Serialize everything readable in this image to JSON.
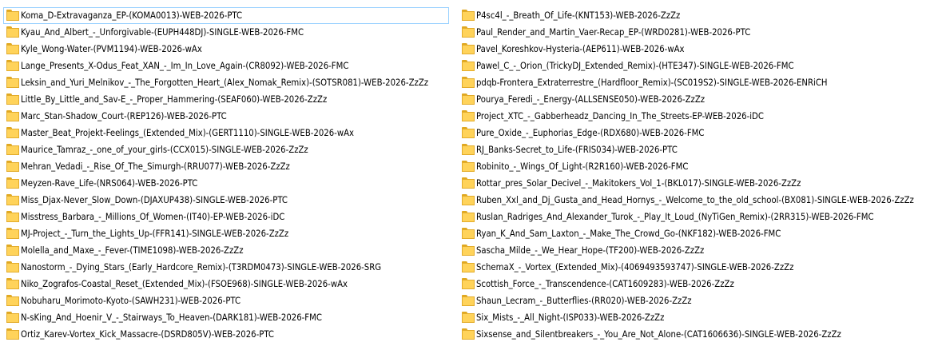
{
  "folders_left": [
    "Koma_D-Extravaganza_EP-(KOMA0013)-WEB-2026-PTC",
    "Kyau_And_Albert_-_Unforgivable-(EUPH448DJ)-SINGLE-WEB-2026-FMC",
    "Kyle_Wong-Water-(PVM1194)-WEB-2026-wAx",
    "Lange_Presents_X-Odus_Feat_XAN_-_Im_In_Love_Again-(CR8092)-WEB-2026-FMC",
    "Leksin_and_Yuri_Melnikov_-_The_Forgotten_Heart_(Alex_Nomak_Remix)-(SOTSR081)-WEB-2026-ZzZz",
    "Little_By_Little_and_Sav-E_-_Proper_Hammering-(SEAF060)-WEB-2026-ZzZz",
    "Marc_Stan-Shadow_Court-(REP126)-WEB-2026-PTC",
    "Master_Beat_Projekt-Feelings_(Extended_Mix)-(GERT1110)-SINGLE-WEB-2026-wAx",
    "Maurice_Tamraz_-_one_of_your_girls-(CCX015)-SINGLE-WEB-2026-ZzZz",
    "Mehran_Vedadi_-_Rise_Of_The_Simurgh-(RRU077)-WEB-2026-ZzZz",
    "Meyzen-Rave_Life-(NRS064)-WEB-2026-PTC",
    "Miss_Djax-Never_Slow_Down-(DJAXUP438)-SINGLE-WEB-2026-PTC",
    "Misstress_Barbara_-_Millions_Of_Women-(IT40)-EP-WEB-2026-iDC",
    "MJ-Project_-_Turn_the_Lights_Up-(FFR141)-SINGLE-WEB-2026-ZzZz",
    "Molella_and_Maxe_-_Fever-(TIME1098)-WEB-2026-ZzZz",
    "Nanostorm_-_Dying_Stars_(Early_Hardcore_Remix)-(T3RDM0473)-SINGLE-WEB-2026-SRG",
    "Niko_Zografos-Coastal_Reset_(Extended_Mix)-(FSOE968)-SINGLE-WEB-2026-wAx",
    "Nobuharu_Morimoto-Kyoto-(SAWH231)-WEB-2026-PTC",
    "N-sKing_And_Hoenir_V_-_Stairways_To_Heaven-(DARK181)-WEB-2026-FMC",
    "Ortiz_Karev-Vortex_Kick_Massacre-(DSRD805V)-WEB-2026-PTC"
  ],
  "folders_right": [
    "P4sc4l_-_Breath_Of_Life-(KNT153)-WEB-2026-ZzZz",
    "Paul_Render_and_Martin_Vaer-Recap_EP-(WRD0281)-WEB-2026-PTC",
    "Pavel_Koreshkov-Hysteria-(AEP611)-WEB-2026-wAx",
    "Pawel_C_-_Orion_(TrickyDJ_Extended_Remix)-(HTE347)-SINGLE-WEB-2026-FMC",
    "pdqb-Frontera_Extraterrestre_(Hardfloor_Remix)-(SC019S2)-SINGLE-WEB-2026-ENRiCH",
    "Pourya_Feredi_-_Energy-(ALLSENSE050)-WEB-2026-ZzZz",
    "Project_XTC_-_Gabberheadz_Dancing_In_The_Streets-EP-WEB-2026-iDC",
    "Pure_Oxide_-_Euphorias_Edge-(RDX680)-WEB-2026-FMC",
    "RJ_Banks-Secret_to_Life-(FRIS034)-WEB-2026-PTC",
    "Robinito_-_Wings_Of_Light-(R2R160)-WEB-2026-FMC",
    "Rottar_pres_Solar_Decivel_-_Makitokers_Vol_1-(BKL017)-SINGLE-WEB-2026-ZzZz",
    "Ruben_Xxl_and_Dj_Gusta_and_Head_Hornys_-_Welcome_to_the_old_school-(BX081)-SINGLE-WEB-2026-ZzZz",
    "Ruslan_Radriges_And_Alexander_Turok_-_Play_It_Loud_(NyTiGen_Remix)-(2RR315)-WEB-2026-FMC",
    "Ryan_K_And_Sam_Laxton_-_Make_The_Crowd_Go-(NKF182)-WEB-2026-FMC",
    "Sascha_Milde_-_We_Hear_Hope-(TF200)-WEB-2026-ZzZz",
    "SchemaX_-_Vortex_(Extended_Mix)-(4069493593747)-SINGLE-WEB-2026-ZzZz",
    "Scottish_Force_-_Transcendence-(CAT1609283)-WEB-2026-ZzZz",
    "Shaun_Lecram_-_Butterflies-(RR020)-WEB-2026-ZzZz",
    "Six_Mists_-_All_Night-(ISP033)-WEB-2026-ZzZz",
    "Sixsense_and_Silentbreakers_-_You_Are_Not_Alone-(CAT1606636)-SINGLE-WEB-2026-ZzZz"
  ],
  "icon": "folder-icon",
  "colors": {
    "folder_fill": "#ffd35a",
    "folder_border": "#e3ac2b",
    "focus_border": "#99d1ff"
  }
}
